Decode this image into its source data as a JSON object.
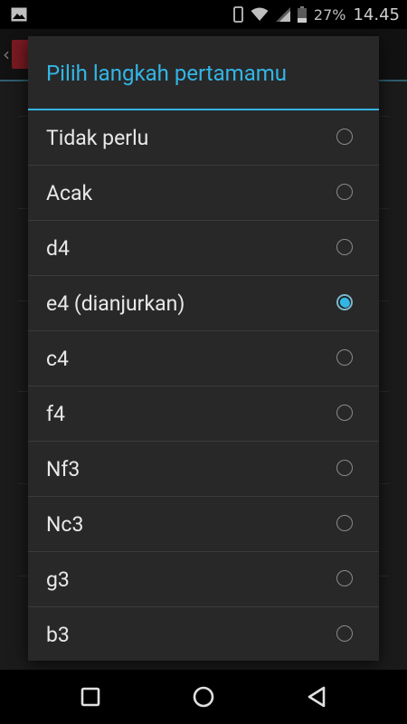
{
  "status_bar": {
    "battery_percent": "27%",
    "time": "14.45",
    "icons": [
      "image-icon",
      "phone-icon",
      "wifi-icon",
      "signal-icon",
      "battery-icon"
    ]
  },
  "dialog": {
    "title": "Pilih langkah pertamamu",
    "accent_color": "#33b5e5",
    "options": [
      {
        "label": "Tidak perlu",
        "selected": false
      },
      {
        "label": "Acak",
        "selected": false
      },
      {
        "label": "d4",
        "selected": false
      },
      {
        "label": "e4 (dianjurkan)",
        "selected": true
      },
      {
        "label": "c4",
        "selected": false
      },
      {
        "label": "f4",
        "selected": false
      },
      {
        "label": "Nf3",
        "selected": false
      },
      {
        "label": "Nc3",
        "selected": false
      },
      {
        "label": "g3",
        "selected": false
      },
      {
        "label": "b3",
        "selected": false
      }
    ]
  },
  "nav_bar": {
    "buttons": [
      "recents-icon",
      "home-icon",
      "back-icon"
    ]
  }
}
